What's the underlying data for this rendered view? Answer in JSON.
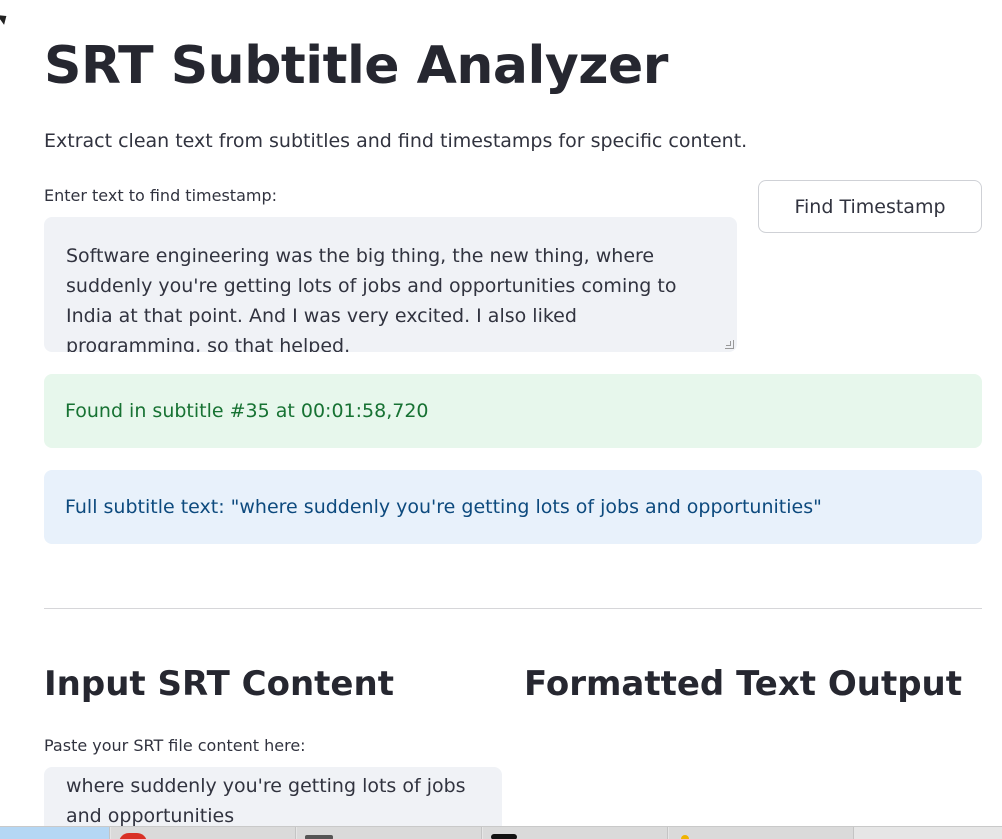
{
  "app": {
    "title": "SRT Subtitle Analyzer",
    "subtitle": "Extract clean text from subtitles and find timestamps for specific content."
  },
  "find": {
    "label": "Enter text to find timestamp:",
    "value": "Software engineering was the big thing, the new thing, where suddenly you're getting lots of jobs and opportunities coming to India at that point. And I was very excited. I also liked programming, so that helped.",
    "button_label": "Find Timestamp"
  },
  "results": {
    "success": "Found in subtitle #35 at 00:01:58,720",
    "info": "Full subtitle text: \"where suddenly you're getting lots of jobs and opportunities\""
  },
  "input_section": {
    "heading": "Input SRT Content",
    "label": "Paste your SRT file content here:",
    "value": " where suddenly you're getting lots of jobs and opportunities"
  },
  "output_section": {
    "heading": "Formatted Text Output"
  },
  "colors": {
    "success_bg": "#e7f7ec",
    "success_text": "#177233",
    "info_bg": "#e8f1fb",
    "info_text": "#0d4a7e",
    "input_bg": "#f0f2f6"
  },
  "taskbar": {
    "items": [
      {
        "icon": "app-icon",
        "active": true
      },
      {
        "icon": "browser-icon",
        "active": false
      },
      {
        "icon": "terminal-icon",
        "active": false
      },
      {
        "icon": "app-icon",
        "active": false
      },
      {
        "icon": "folder-icon",
        "active": false
      }
    ]
  }
}
